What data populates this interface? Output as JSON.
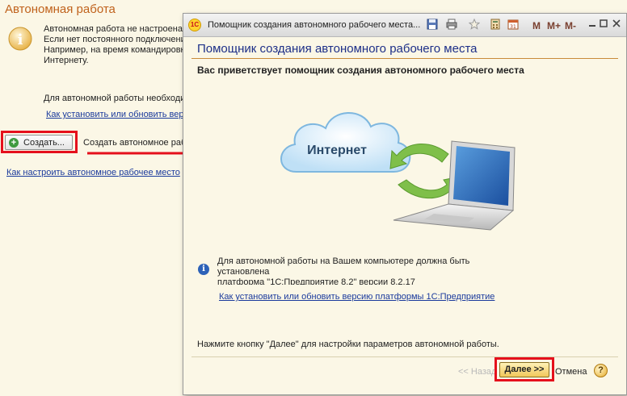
{
  "background": {
    "title": "Автономная работа",
    "notice_lines": [
      "Автономная работа не настроена",
      "Если нет постоянного подключения",
      "Например, на время командировки",
      "Интернету."
    ],
    "need_text": "Для автономной работы необходимо",
    "howto_link": "Как установить или обновить версию",
    "create_button": "Создать...",
    "create_desc": "Создать автономное рабочее",
    "setup_link": "Как настроить автономное рабочее место"
  },
  "wizard": {
    "window_title": "Помощник создания автономного рабочего места...",
    "app_icon_text": "1С",
    "toolbar": {
      "m_label": "M",
      "m_plus_label": "M+",
      "m_minus_label": "M-"
    },
    "heading": "Помощник создания автономного рабочего места",
    "welcome": "Вас приветствует помощник создания автономного рабочего места",
    "cloud_label": "Интернет",
    "note_lines": [
      "Для автономной работы на Вашем компьютере должна быть",
      "установлена",
      "платформа \"1С:Предприятие 8.2\" версии 8.2.17"
    ],
    "platform_link": "Как установить или обновить версию платформы 1С:Предприятие",
    "bottom_text": "Нажмите кнопку \"Далее\" для настройки параметров автономной работы.",
    "back_button": "<< Назад",
    "next_button": "Далее >>",
    "cancel_button": "Отмена",
    "help_button": "?"
  },
  "colors": {
    "background": "#fbf7e6",
    "heading": "#1d2f88",
    "title_orange": "#c0621c",
    "highlight_red": "#e5101c",
    "link": "#1a3a9c"
  }
}
